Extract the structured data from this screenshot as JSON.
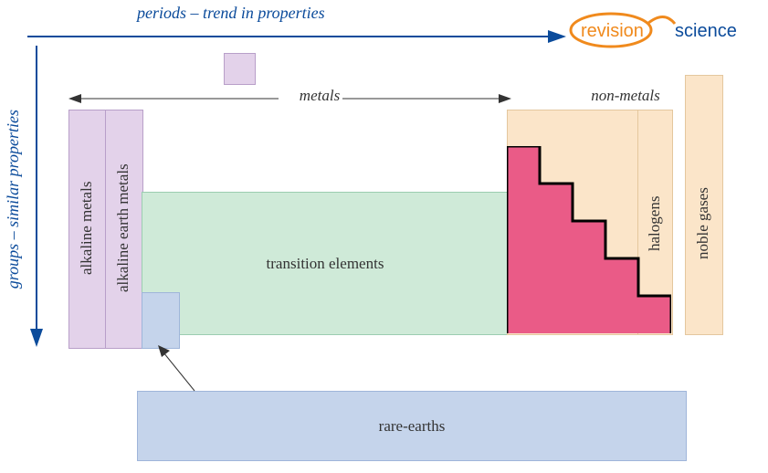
{
  "axes": {
    "periods_label": "periods – trend in properties",
    "groups_label": "groups – similar properties"
  },
  "headers": {
    "metals": "metals",
    "nonmetals": "non-metals"
  },
  "regions": {
    "alkaline_metals": "alkaline metals",
    "alkaline_earth_metals": "alkaline earth metals",
    "transition_elements": "transition elements",
    "halogens": "halogens",
    "noble_gases": "noble gases",
    "rare_earths": "rare-earths"
  },
  "logo": {
    "left": "revision",
    "right": "science"
  }
}
